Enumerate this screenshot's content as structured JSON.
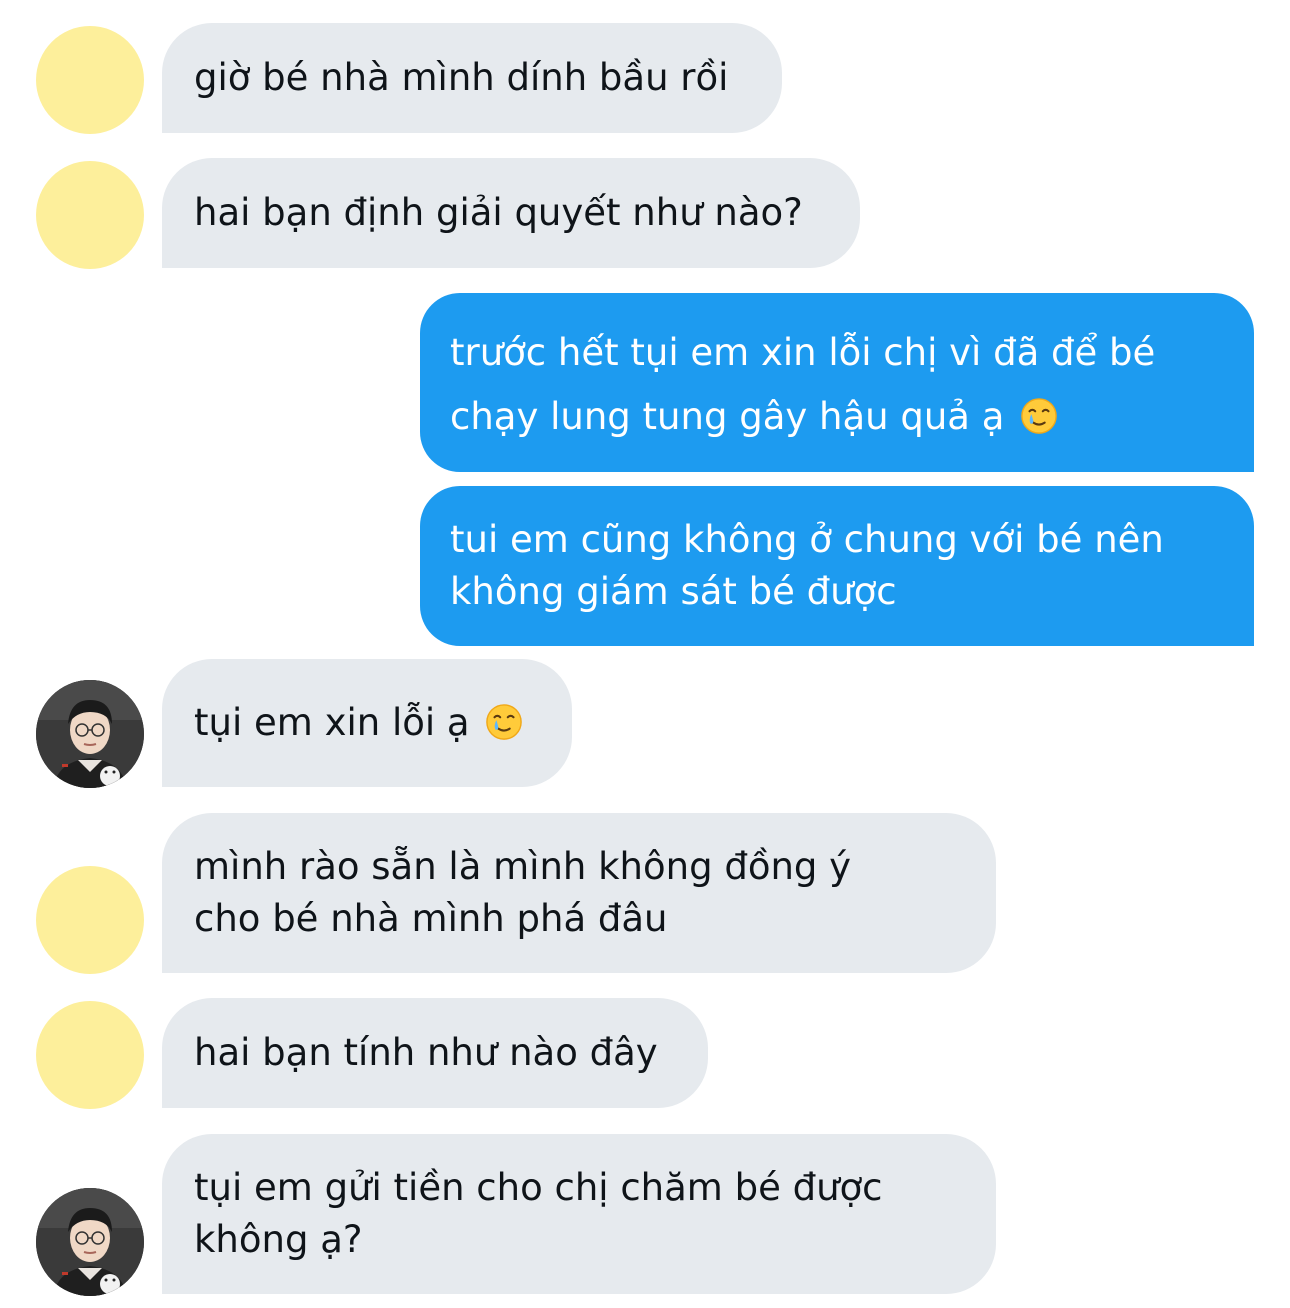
{
  "conversation": {
    "messages": [
      {
        "lines": [
          "giờ bé nhà mình dính bầu rồi"
        ]
      },
      {
        "lines": [
          "hai bạn định giải quyết như nào?"
        ]
      },
      {
        "lines": [
          "trước hết tụi em xin lỗi chị vì đã để bé",
          "chạy lung tung gây hậu quả ạ"
        ],
        "emoji": "crying-smile-face-emoji"
      },
      {
        "lines": [
          "tui em cũng không ở chung với bé nên",
          "không giám sát bé được"
        ]
      },
      {
        "lines": [
          "tụi em xin lỗi ạ"
        ],
        "emoji": "crying-smile-face-emoji"
      },
      {
        "lines": [
          "mình rào sẵn là mình không đồng ý",
          "cho bé nhà mình phá đâu"
        ]
      },
      {
        "lines": [
          "hai bạn tính như nào đây"
        ]
      },
      {
        "lines": [
          "tụi em gửi tiền cho chị chăm bé được",
          "không ạ?"
        ]
      }
    ]
  },
  "colors": {
    "incoming_bubble": "#e6eaee",
    "outgoing_bubble": "#1d9bf0",
    "incoming_text": "#0f1419",
    "outgoing_text": "#ffffff",
    "default_avatar": "#fdef9b"
  }
}
